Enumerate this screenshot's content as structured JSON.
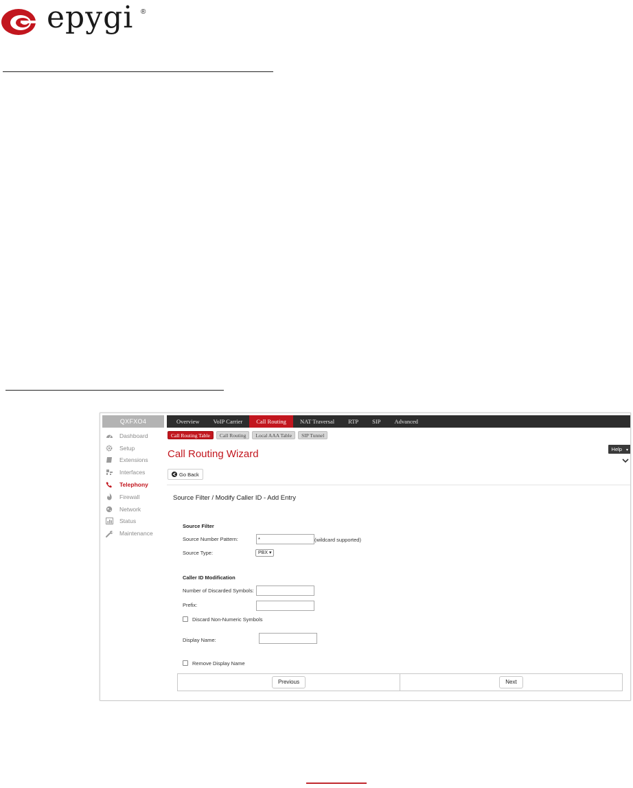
{
  "brand": {
    "name": "epygi",
    "registered": "®",
    "accent": "#c2161e"
  },
  "device": {
    "name": "QXFXO4"
  },
  "sidebar": {
    "items": [
      {
        "label": "Dashboard",
        "icon": "dashboard-icon"
      },
      {
        "label": "Setup",
        "icon": "gear-icon"
      },
      {
        "label": "Extensions",
        "icon": "book-icon"
      },
      {
        "label": "Interfaces",
        "icon": "network-plug-icon"
      },
      {
        "label": "Telephony",
        "icon": "phone-icon",
        "active": true
      },
      {
        "label": "Firewall",
        "icon": "flame-icon"
      },
      {
        "label": "Network",
        "icon": "globe-icon"
      },
      {
        "label": "Status",
        "icon": "bar-chart-icon"
      },
      {
        "label": "Maintenance",
        "icon": "wrench-icon"
      }
    ]
  },
  "topnav": {
    "tabs": [
      {
        "label": "Overview"
      },
      {
        "label": "VoIP Carrier"
      },
      {
        "label": "Call Routing",
        "active": true
      },
      {
        "label": "NAT Traversal"
      },
      {
        "label": "RTP"
      },
      {
        "label": "SIP"
      },
      {
        "label": "Advanced"
      }
    ]
  },
  "subtabs": [
    {
      "label": "Call Routing Table",
      "active": true
    },
    {
      "label": "Call Routing"
    },
    {
      "label": "Local AAA Table"
    },
    {
      "label": "SIP Tunnel"
    }
  ],
  "page": {
    "title": "Call Routing Wizard",
    "help_label": "Help",
    "goback_label": "Go Back"
  },
  "form": {
    "title": "Source Filter / Modify Caller ID - Add Entry",
    "source_filter": {
      "heading": "Source Filter",
      "pattern_label": "Source Number Pattern:",
      "pattern_value": "*",
      "pattern_hint": "(wildcard supported)",
      "type_label": "Source Type:",
      "type_value": "PBX ▾"
    },
    "caller_id": {
      "heading": "Caller ID Modification",
      "discarded_label": "Number of Discarded Symbols:",
      "discarded_value": "",
      "prefix_label": "Prefix:",
      "prefix_value": "",
      "discard_nonnumeric_label": "Discard Non-Numeric Symbols",
      "display_name_label": "Display Name:",
      "display_name_value": "",
      "remove_display_label": "Remove Display Name"
    },
    "buttons": {
      "previous": "Previous",
      "next": "Next"
    }
  }
}
